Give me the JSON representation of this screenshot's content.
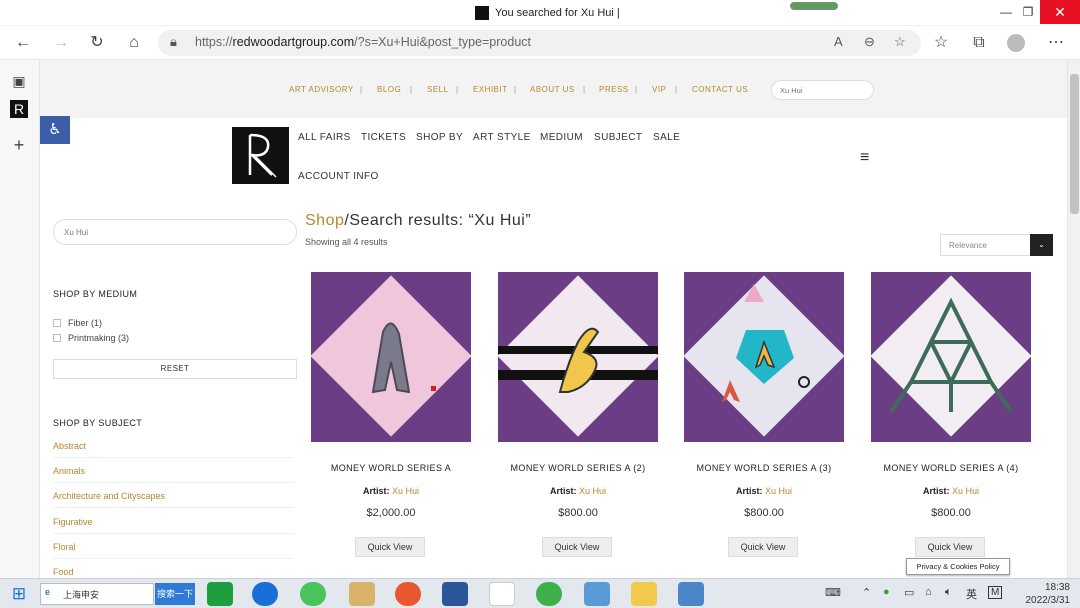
{
  "window": {
    "tab_title": "You searched for Xu Hui |",
    "minimize": "—",
    "restore": "❐",
    "close": "✕"
  },
  "address": {
    "url_prefix": "https://",
    "url_domain": "redwoodartgroup.com",
    "url_rest": "/?s=Xu+Hui&post_type=product"
  },
  "topnav": {
    "items": [
      "ART ADVISORY",
      "BLOG",
      "SELL",
      "EXHIBIT",
      "ABOUT US",
      "PRESS",
      "VIP",
      "CONTACT US"
    ],
    "search_value": "Xu Hui"
  },
  "mainnav": {
    "items": [
      "ALL FAIRS",
      "TICKETS",
      "SHOP BY",
      "ART STYLE",
      "MEDIUM",
      "SUBJECT",
      "SALE"
    ],
    "account": "ACCOUNT INFO"
  },
  "sidebar": {
    "search_value": "Xu Hui",
    "medium_heading": "SHOP BY MEDIUM",
    "medium_options": [
      "Fiber (1)",
      "Printmaking (3)"
    ],
    "reset_label": "RESET",
    "subject_heading": "SHOP BY SUBJECT",
    "subjects": [
      "Abstract",
      "Animals",
      "Architecture and Cityscapes",
      "Figurative",
      "Floral",
      "Food"
    ]
  },
  "results": {
    "crumb_shop": "Shop",
    "crumb_rest": "/Search results: “Xu Hui”",
    "count": "Showing all 4 results",
    "sort": "Relevance",
    "sort_arrow": "⌄"
  },
  "products": [
    {
      "name": "MONEY WORLD SERIES A",
      "artist_label": "Artist:",
      "artist": "Xu Hui",
      "price": "$2,000.00",
      "button": "Quick View"
    },
    {
      "name": "MONEY WORLD SERIES A (2)",
      "artist_label": "Artist:",
      "artist": "Xu Hui",
      "price": "$800.00",
      "button": "Quick View"
    },
    {
      "name": "MONEY WORLD SERIES A (3)",
      "artist_label": "Artist:",
      "artist": "Xu Hui",
      "price": "$800.00",
      "button": "Quick View"
    },
    {
      "name": "MONEY WORLD SERIES A (4)",
      "artist_label": "Artist:",
      "artist": "Xu Hui",
      "price": "$800.00",
      "button": "Quick View"
    }
  ],
  "cookie": "Privacy & Cookies Policy",
  "taskbar": {
    "ie_text": "上海申安",
    "search_button": "搜索一下",
    "ime": "英",
    "m": "M",
    "time": "18:38",
    "date": "2022/3/31"
  },
  "colors": {
    "gold": "#b3892d",
    "purple": "#6a3d84",
    "accessibility": "#3c5ea8"
  }
}
